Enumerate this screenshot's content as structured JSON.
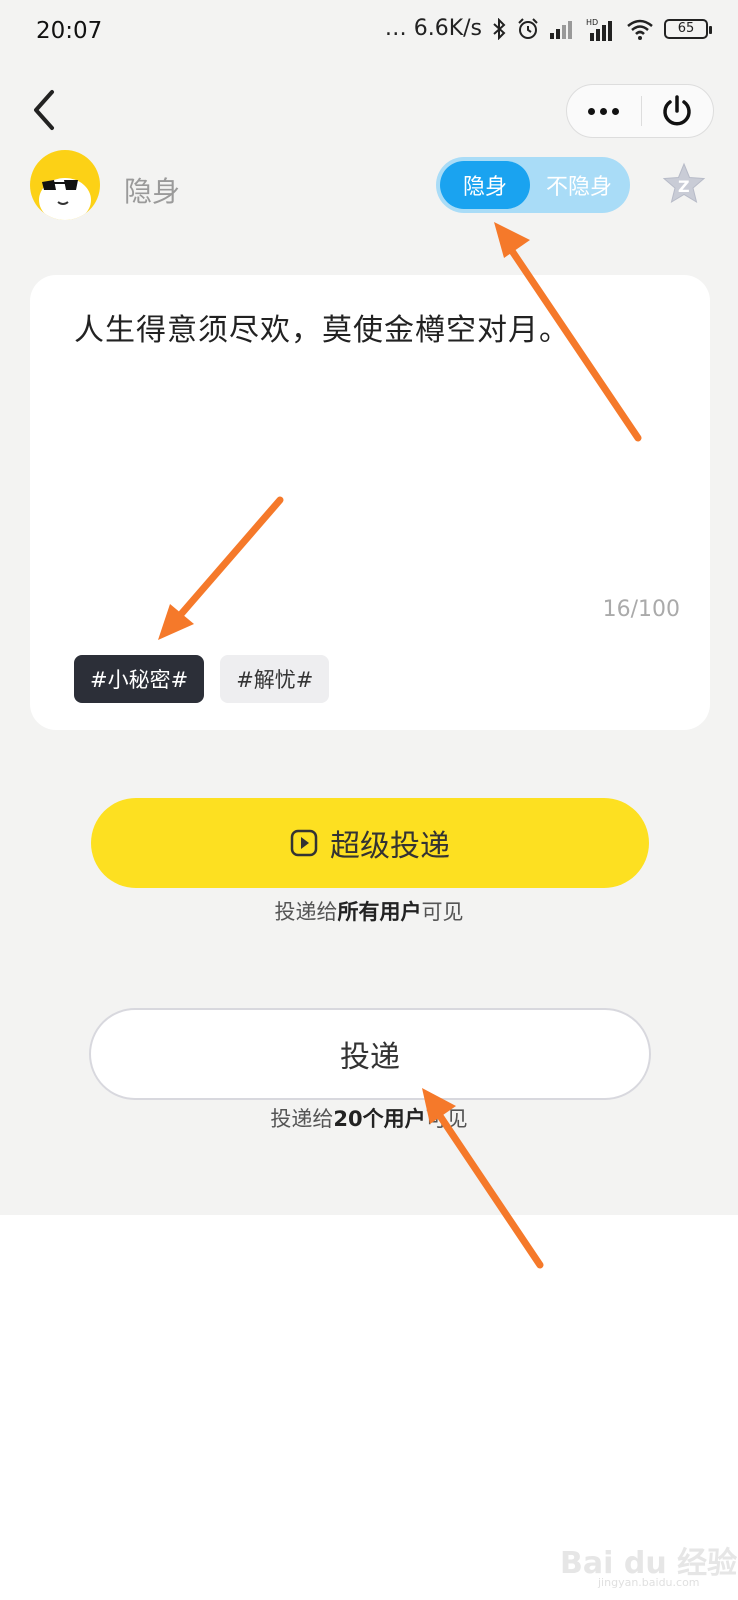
{
  "status_bar": {
    "time": "20:07",
    "network_speed": "… 6.6K/s",
    "battery_level": "65"
  },
  "header": {
    "back_icon": "chevron-left-icon",
    "more_icon": "more-dots-icon",
    "power_icon": "power-icon"
  },
  "user": {
    "name": "隐身",
    "toggle_on_label": "隐身",
    "toggle_off_label": "不隐身",
    "star_icon": "star-icon"
  },
  "post": {
    "content": "人生得意须尽欢，莫使金樽空对月。",
    "counter": "16/100",
    "tags": [
      {
        "label": "#小秘密#",
        "selected": true
      },
      {
        "label": "#解忧#",
        "selected": false
      }
    ]
  },
  "super_deliver": {
    "label": "超级投递",
    "caption_prefix": "投递给",
    "caption_bold": "所有用户",
    "caption_suffix": "可见",
    "color": "#fde021"
  },
  "deliver": {
    "label": "投递",
    "caption_prefix": "投递给",
    "caption_bold": "20个用户",
    "caption_suffix": "可见"
  },
  "colors": {
    "accent": "#1aa3f0",
    "arrow": "#f5792a"
  },
  "watermark": {
    "text": "Bai du 经验",
    "url": "jingyan.baidu.com"
  }
}
